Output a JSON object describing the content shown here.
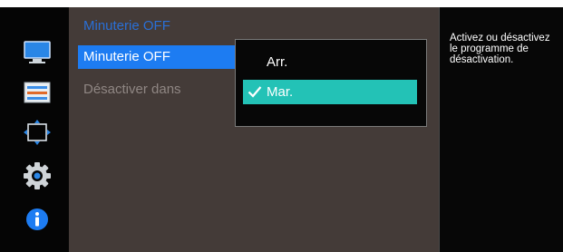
{
  "menu": {
    "title": "Minuterie OFF",
    "items": [
      {
        "label": "Minuterie OFF",
        "state": "selected"
      },
      {
        "label": "Désactiver dans",
        "state": "disabled"
      }
    ]
  },
  "popup": {
    "options": [
      {
        "label": "Arr.",
        "selected": false
      },
      {
        "label": "Mar.",
        "selected": true
      }
    ]
  },
  "help": {
    "text": "Activez ou désactivez\nle programme de\ndésactivation."
  },
  "sidebar": {
    "icons": [
      "monitor-icon",
      "color-bars-icon",
      "screen-resize-icon",
      "gear-icon",
      "info-icon"
    ]
  },
  "colors": {
    "selected_item": "#1d7cf2",
    "selected_option": "#23c2b6",
    "title": "#2a6fd6",
    "panel": "#443b38"
  }
}
